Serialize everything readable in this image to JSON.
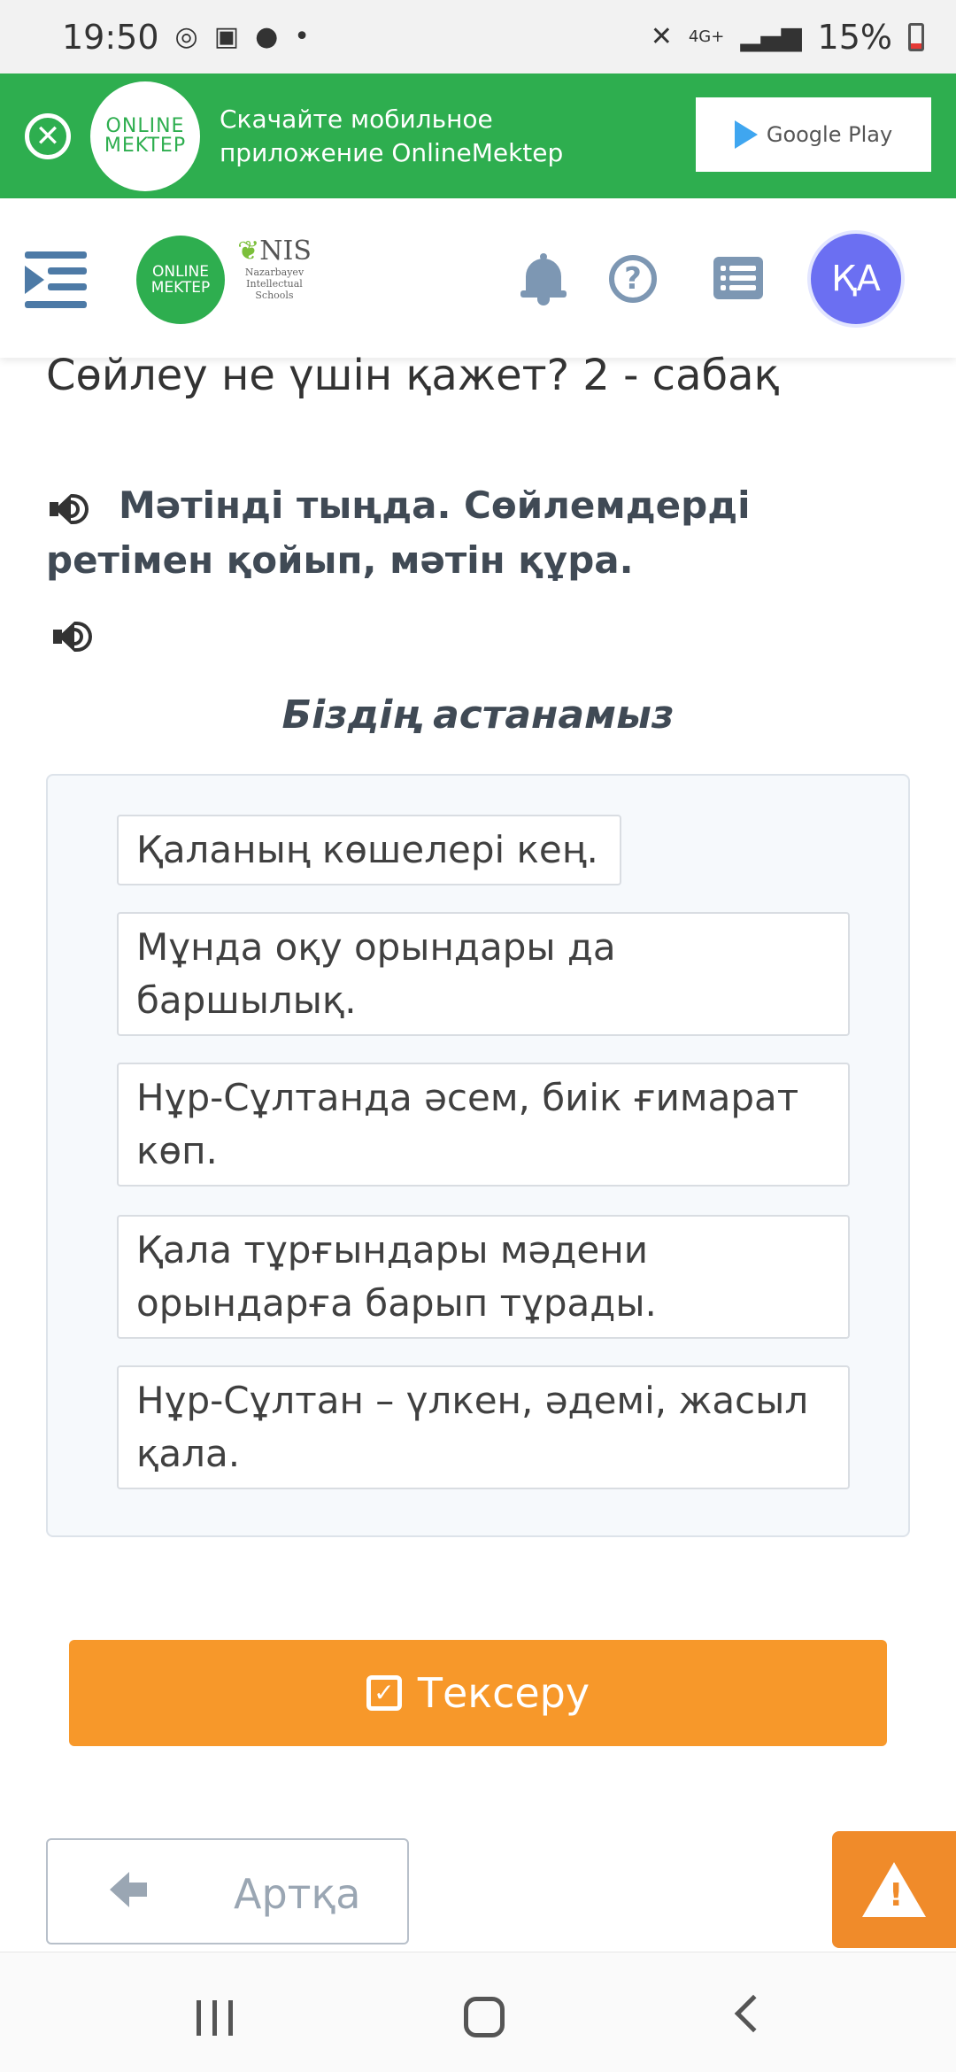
{
  "status_bar": {
    "time": "19:50",
    "battery": "15%",
    "network": "4G+",
    "icons": [
      "sync-icon",
      "image-icon",
      "facebook-icon",
      "dot-icon",
      "mute-icon",
      "signal-icon",
      "battery-icon"
    ]
  },
  "banner": {
    "logo_line1": "ONLINE",
    "logo_line2": "MEKTEP",
    "text": "Скачайте мобильное приложение OnlineMektep",
    "store_button": "Google Play"
  },
  "header": {
    "logo_line1": "ONLINE",
    "logo_line2": "MEKTEP",
    "nis_title": "NIS",
    "nis_sub": "Nazarbayev Intellectual Schools",
    "avatar_initials": "ҚА"
  },
  "lesson": {
    "title": "Сөйлеу не үшін қажет? 2 - сабақ",
    "task": "Мәтінді тыңда. Сөйлемдерді ретімен қойып, мәтін құра.",
    "subtitle": "Біздің астанамыз",
    "sentences": [
      "Қаланың көшелері кең.",
      "Мұнда оқу орындары да баршылық.",
      "Нұр-Сұлтанда әсем, биік ғимарат көп.",
      "Қала тұрғындары мәдени орындарға барып тұрады.",
      "Нұр-Сұлтан – үлкен, әдемі, жасыл қала."
    ]
  },
  "actions": {
    "check_label": "Тексеру",
    "back_label": "Артқа"
  },
  "colors": {
    "brand_green": "#2eae4f",
    "accent_orange": "#f7982a",
    "avatar_purple": "#6b6ff2"
  }
}
